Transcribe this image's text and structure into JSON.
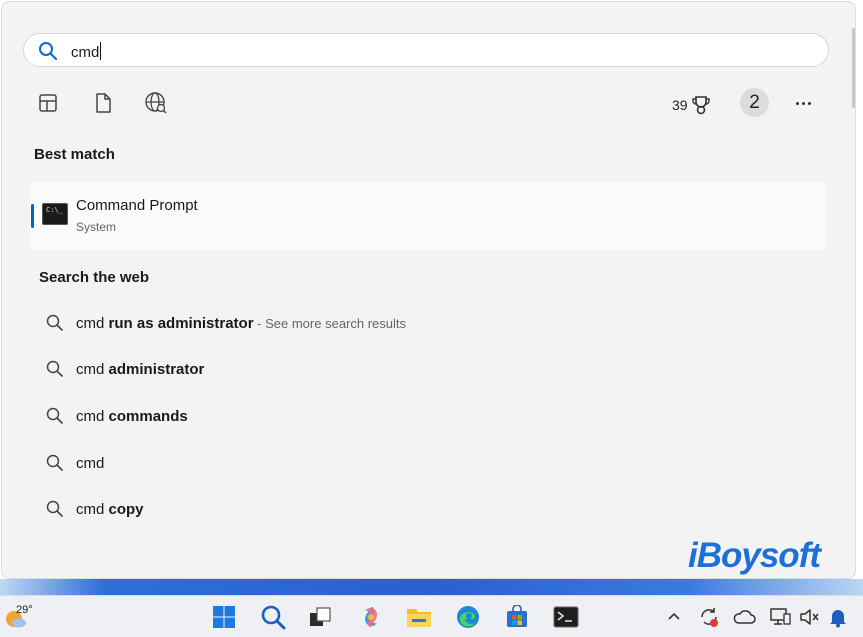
{
  "search": {
    "value": "cmd"
  },
  "toolbar": {
    "filters": [
      {
        "icon": "apps-icon"
      },
      {
        "icon": "document-icon"
      },
      {
        "icon": "web-icon"
      }
    ],
    "points": "39",
    "avatar_label": "2"
  },
  "best_match": {
    "heading": "Best match",
    "app_name": "Command Prompt",
    "app_type": "System",
    "app_icon_text": "C:\\_"
  },
  "web": {
    "heading": "Search the web",
    "items": [
      {
        "prefix": "cmd ",
        "bold": "run as administrator",
        "suffix": " - See more search results"
      },
      {
        "prefix": "cmd ",
        "bold": "administrator",
        "suffix": ""
      },
      {
        "prefix": "cmd ",
        "bold": "commands",
        "suffix": ""
      },
      {
        "prefix": "cmd",
        "bold": "",
        "suffix": ""
      },
      {
        "prefix": "cmd ",
        "bold": "copy",
        "suffix": ""
      }
    ]
  },
  "watermark": "iBoysoft",
  "taskbar": {
    "weather_temp": "29°",
    "apps": [
      "windows-start-icon",
      "search-icon",
      "task-view-icon",
      "copilot-icon",
      "file-explorer-icon",
      "edge-icon",
      "store-icon",
      "terminal-icon"
    ],
    "tray": [
      "chevron-up-icon",
      "sync-icon",
      "onedrive-icon",
      "network-icon",
      "volume-mute-icon",
      "bell-icon"
    ]
  },
  "colors": {
    "accent": "#0067c0",
    "brand": "#1e6fd6",
    "panel": "#f3f3f3"
  }
}
